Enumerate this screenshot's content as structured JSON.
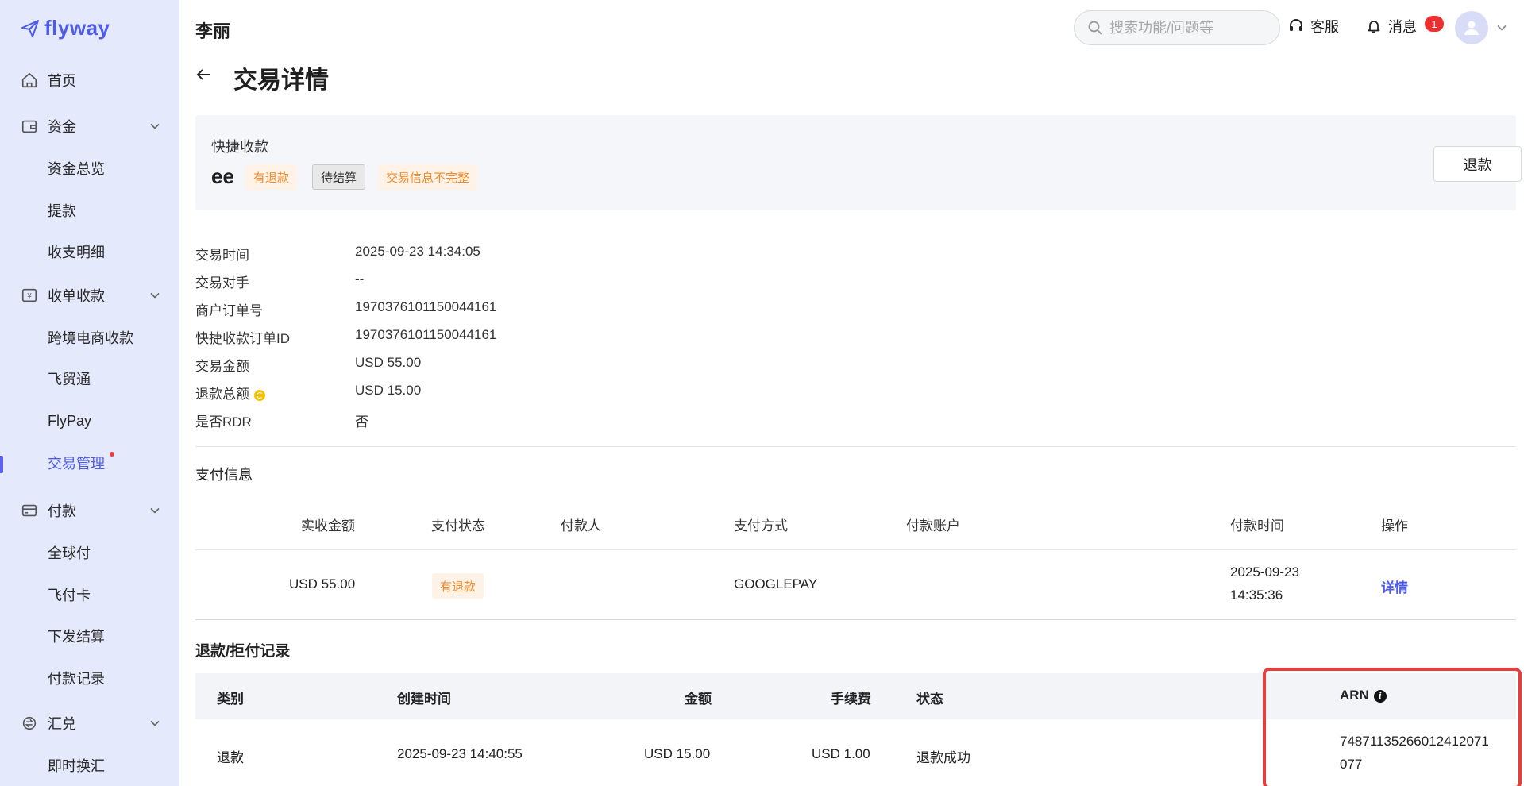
{
  "brand": {
    "logo_text": "flyway",
    "accent": "#4f5ce8"
  },
  "sidebar": {
    "items": [
      {
        "label": "首页",
        "icon": "home-icon"
      },
      {
        "label": "资金",
        "icon": "wallet-icon"
      },
      {
        "label": "资金总览"
      },
      {
        "label": "提款"
      },
      {
        "label": "收支明细"
      },
      {
        "label": "收单收款",
        "icon": "yen-icon"
      },
      {
        "label": "跨境电商收款"
      },
      {
        "label": "飞贸通"
      },
      {
        "label": "FlyPay"
      },
      {
        "label": "交易管理"
      },
      {
        "label": "付款",
        "icon": "card-icon"
      },
      {
        "label": "全球付"
      },
      {
        "label": "飞付卡"
      },
      {
        "label": "下发结算"
      },
      {
        "label": "付款记录"
      },
      {
        "label": "汇兑",
        "icon": "exchange-icon"
      },
      {
        "label": "即时换汇"
      }
    ]
  },
  "header": {
    "user_name": "李丽",
    "search_placeholder": "搜索功能/问题等",
    "service_label": "客服",
    "messages_label": "消息",
    "messages_badge": "1"
  },
  "page": {
    "title": "交易详情"
  },
  "summary": {
    "type": "快捷收款",
    "name": "ee",
    "tags": [
      "有退款",
      "待结算",
      "交易信息不完整"
    ],
    "refund_button": "退款"
  },
  "info": [
    {
      "key": "交易时间",
      "value": "2025-09-23 14:34:05"
    },
    {
      "key": "交易对手",
      "value": "--"
    },
    {
      "key": "商户订单号",
      "value": "1970376101150044161"
    },
    {
      "key": "快捷收款订单ID",
      "value": "1970376101150044161"
    },
    {
      "key": "交易金额",
      "value": "USD 55.00"
    },
    {
      "key": "退款总额",
      "value": "USD 15.00"
    },
    {
      "key": "是否RDR",
      "value": "否"
    }
  ],
  "payment": {
    "section_title": "支付信息",
    "headers": [
      "实收金额",
      "支付状态",
      "付款人",
      "支付方式",
      "付款账户",
      "付款时间",
      "操作"
    ],
    "row": {
      "amount": "USD 55.00",
      "status": "有退款",
      "payer": "",
      "method": "GOOGLEPAY",
      "account": "",
      "time_date": "2025-09-23",
      "time_clock": "14:35:36",
      "action": "详情"
    }
  },
  "refunds": {
    "section_title": "退款/拒付记录",
    "headers": [
      "类别",
      "创建时间",
      "金额",
      "手续费",
      "状态",
      "ARN"
    ],
    "row": {
      "category": "退款",
      "created": "2025-09-23 14:40:55",
      "amount": "USD 15.00",
      "fee": "USD 1.00",
      "status": "退款成功",
      "arn_line1": "74871135266012412071",
      "arn_line2": "077"
    }
  }
}
